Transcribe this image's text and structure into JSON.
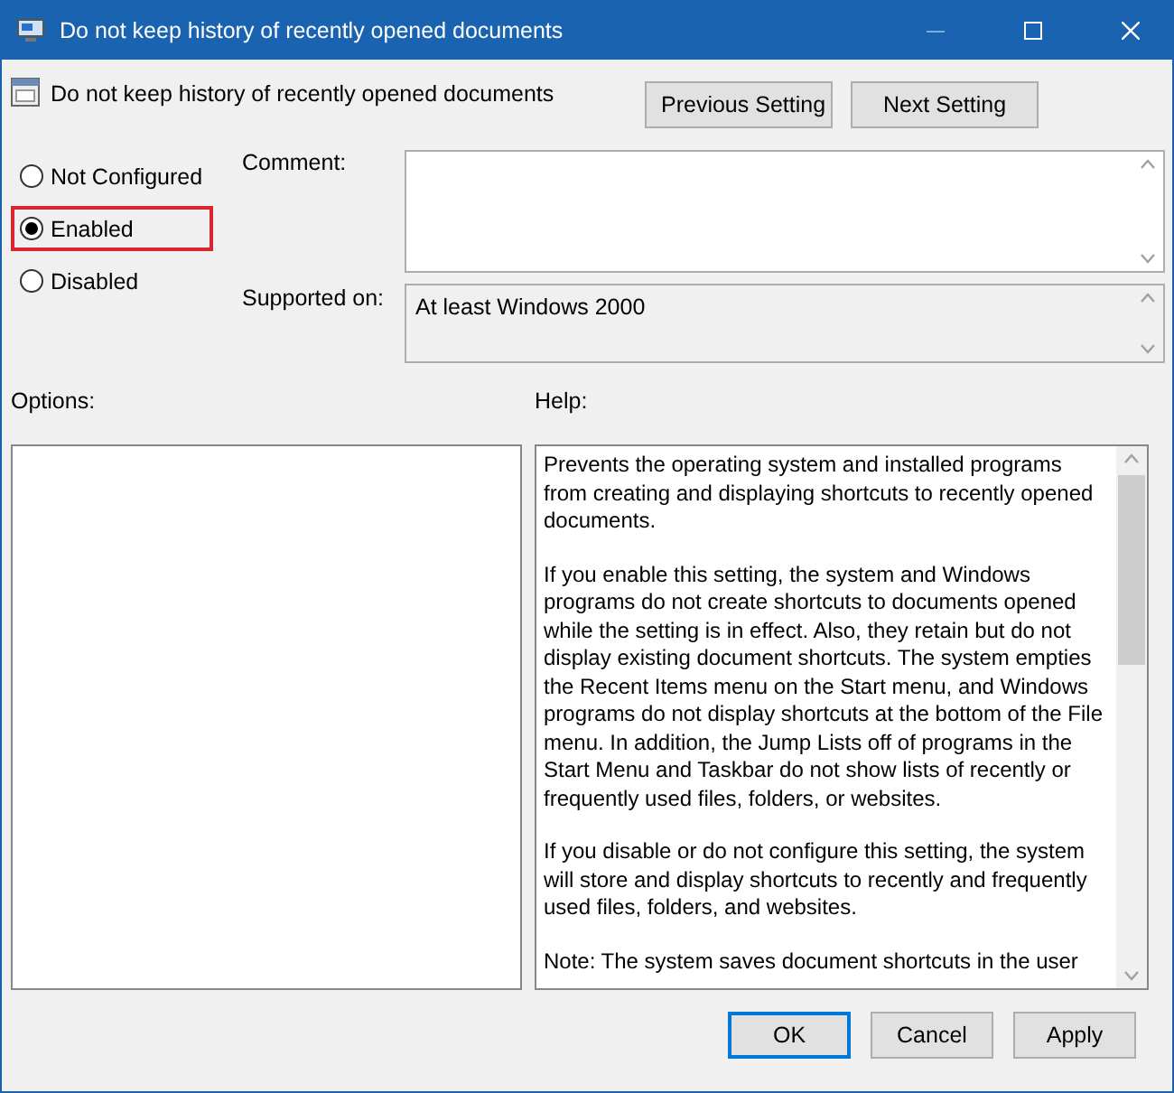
{
  "window": {
    "title": "Do not keep history of recently opened documents"
  },
  "header": {
    "policy_name": "Do not keep history of recently opened documents",
    "buttons": [
      "Previous Setting",
      "Next Setting"
    ]
  },
  "state_options": [
    {
      "label": "Not Configured",
      "selected": false,
      "highlighted": false
    },
    {
      "label": "Enabled",
      "selected": true,
      "highlighted": true
    },
    {
      "label": "Disabled",
      "selected": false,
      "highlighted": false
    }
  ],
  "comment": {
    "label": "Comment:"
  },
  "supported_on": {
    "label": "Supported on:",
    "value": "At least Windows 2000"
  },
  "options": {
    "label": "Options:"
  },
  "help": {
    "label": "Help:",
    "paragraphs": [
      "Prevents the operating system and installed programs from creating and displaying shortcuts to recently opened documents.",
      "If you enable this setting, the system and Windows programs do not create shortcuts to documents opened while the setting is in effect. Also, they retain but do not display existing document shortcuts. The system empties the Recent Items menu on the Start menu, and Windows programs do not display shortcuts at the bottom of the File menu. In addition, the Jump Lists off of programs in the Start Menu and Taskbar do not show lists of recently or frequently used files, folders, or websites.",
      "If you disable or do not configure this setting, the system will store and display shortcuts to recently and frequently used files, folders, and websites.",
      "Note: The system saves document shortcuts in the user"
    ]
  },
  "footer": {
    "buttons": [
      {
        "label": "OK",
        "kind": "default"
      },
      {
        "label": "Cancel",
        "kind": "normal"
      },
      {
        "label": "Apply",
        "kind": "normal"
      }
    ]
  }
}
